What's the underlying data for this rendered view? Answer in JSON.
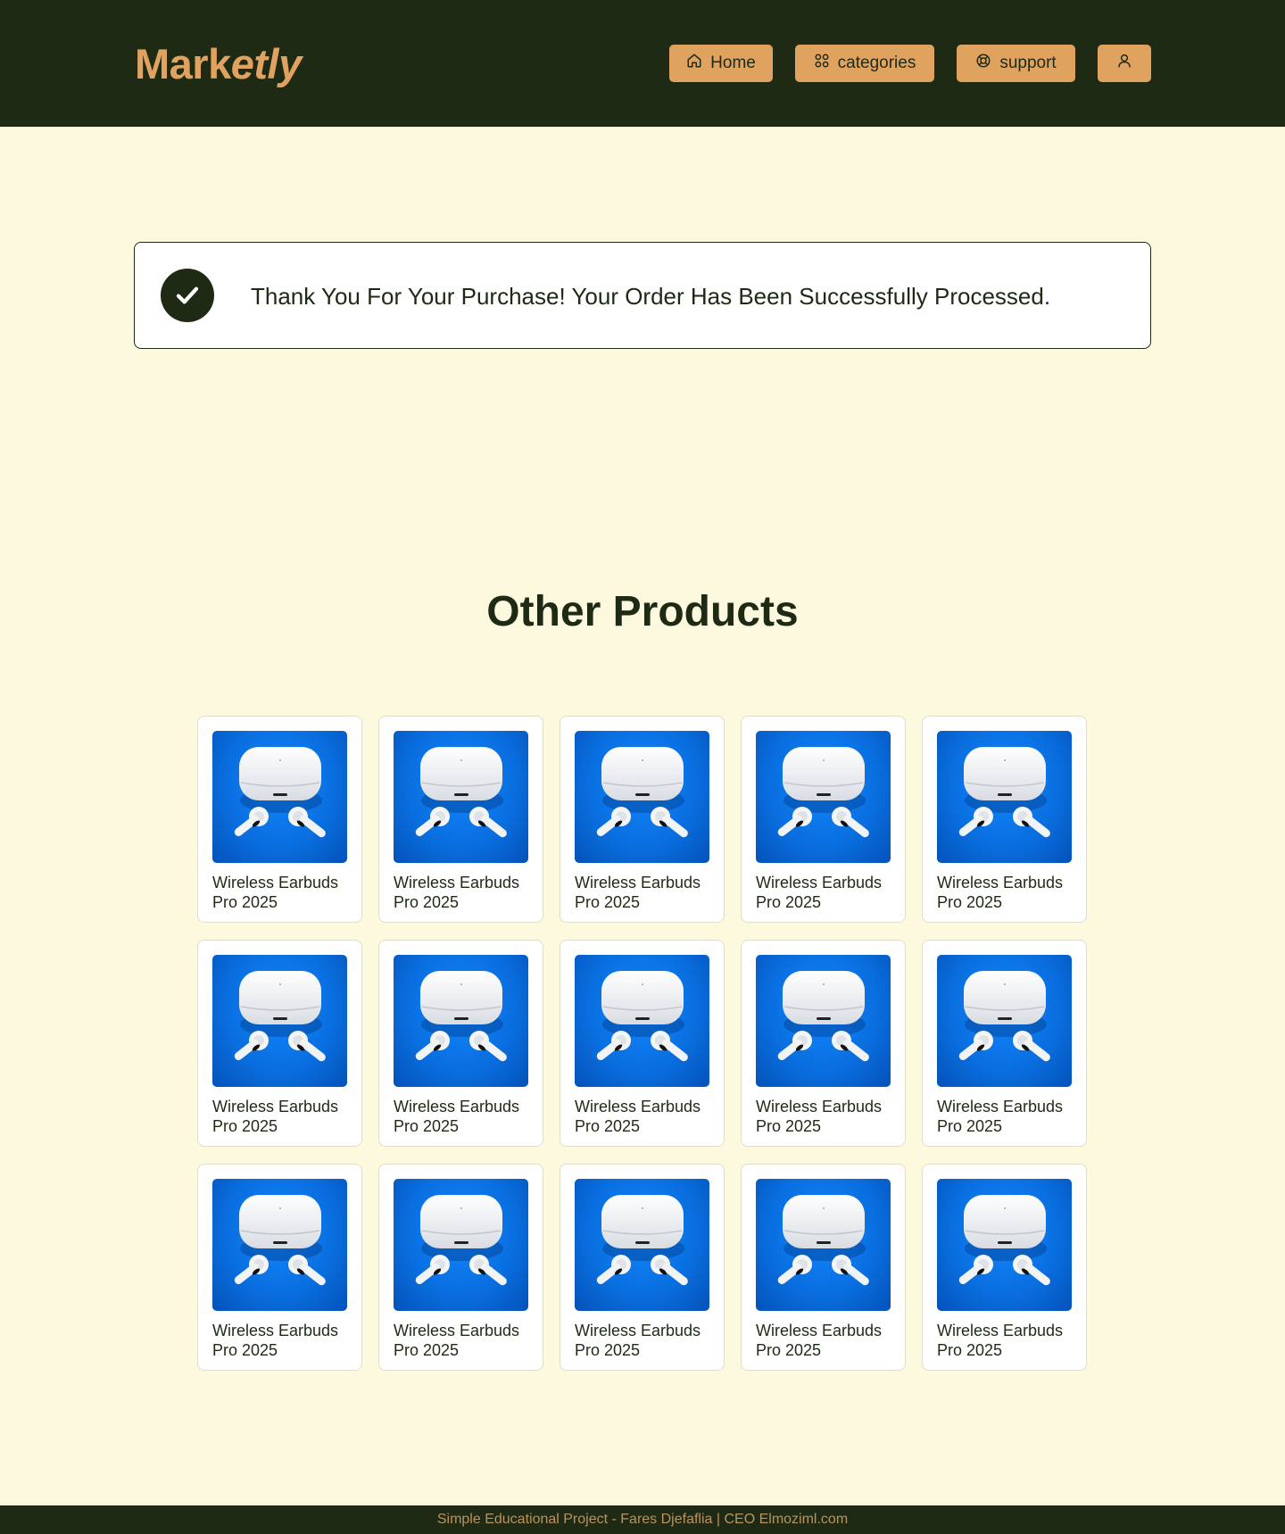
{
  "header": {
    "logo_bold": "Mark",
    "logo_italic": "etly",
    "nav": [
      {
        "label": "Home",
        "icon": "home-icon"
      },
      {
        "label": "categories",
        "icon": "grid-icon"
      },
      {
        "label": "support",
        "icon": "lifebuoy-icon"
      },
      {
        "label": "",
        "icon": "user-icon"
      }
    ]
  },
  "success": {
    "message": "Thank You For Your Purchase! Your Order Has Been Successfully Processed.",
    "icon": "check-icon"
  },
  "other_products": {
    "title": "Other Products",
    "items": [
      {
        "name": "Wireless Earbuds Pro 2025"
      },
      {
        "name": "Wireless Earbuds Pro 2025"
      },
      {
        "name": "Wireless Earbuds Pro 2025"
      },
      {
        "name": "Wireless Earbuds Pro 2025"
      },
      {
        "name": "Wireless Earbuds Pro 2025"
      },
      {
        "name": "Wireless Earbuds Pro 2025"
      },
      {
        "name": "Wireless Earbuds Pro 2025"
      },
      {
        "name": "Wireless Earbuds Pro 2025"
      },
      {
        "name": "Wireless Earbuds Pro 2025"
      },
      {
        "name": "Wireless Earbuds Pro 2025"
      },
      {
        "name": "Wireless Earbuds Pro 2025"
      },
      {
        "name": "Wireless Earbuds Pro 2025"
      },
      {
        "name": "Wireless Earbuds Pro 2025"
      },
      {
        "name": "Wireless Earbuds Pro 2025"
      },
      {
        "name": "Wireless Earbuds Pro 2025"
      }
    ]
  },
  "footer": {
    "text": "Simple Educational Project - Fares Djefaflia | CEO Elmoziml.com"
  },
  "colors": {
    "header_bg": "#1f2a14",
    "accent": "#e0a35f",
    "page_bg": "#fdf9df",
    "product_bg": "#0a6fe0"
  }
}
